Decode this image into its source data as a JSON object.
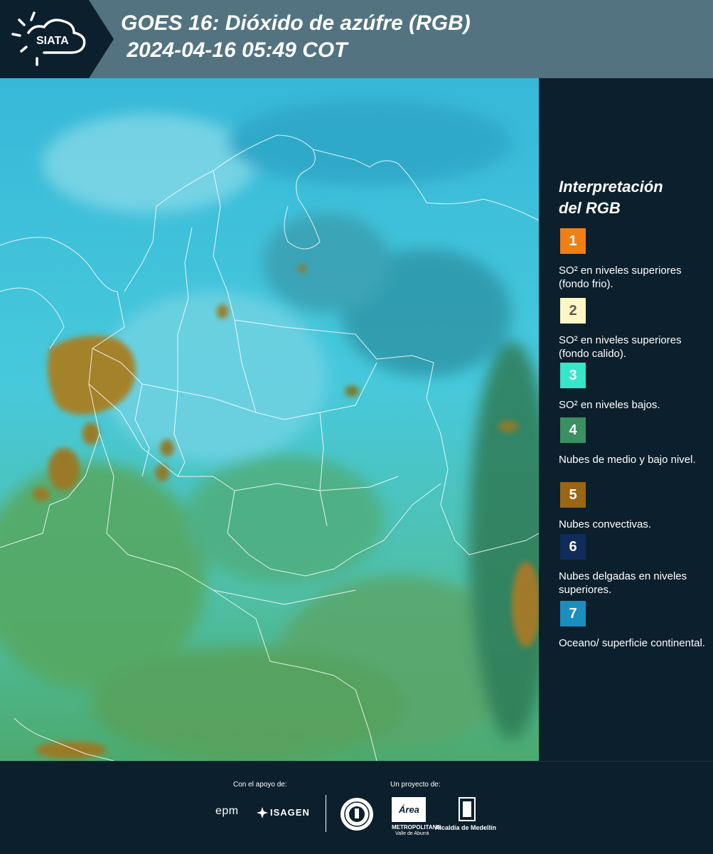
{
  "header": {
    "logo_text": "SIATA",
    "title_line1": "GOES 16: Dióxido de azúfre (RGB)",
    "title_line2": " 2024-04-16 05:49 COT"
  },
  "legend": {
    "title_line1": "Interpretación",
    "title_line2": "del RGB",
    "items": [
      {
        "number": "1",
        "color": "#f07f14",
        "text_color": "#ffffff",
        "description": "SO² en niveles superiores (fondo frio)."
      },
      {
        "number": "2",
        "color": "#fdf7c4",
        "text_color": "#5a5a5a",
        "description": "SO² en niveles superiores (fondo calido)."
      },
      {
        "number": "3",
        "color": "#35e6c8",
        "text_color": "#ffffff",
        "description": "SO² en niveles bajos."
      },
      {
        "number": "4",
        "color": "#3a8f63",
        "text_color": "#ffffff",
        "description": "Nubes de medio y bajo nivel."
      },
      {
        "number": "5",
        "color": "#9a6614",
        "text_color": "#ffffff",
        "description": "Nubes convectivas."
      },
      {
        "number": "6",
        "color": "#0f2c5b",
        "text_color": "#ffffff",
        "description": "Nubes delgadas en niveles superiores."
      },
      {
        "number": "7",
        "color": "#1b8ec0",
        "text_color": "#ffffff",
        "description": "Oceano/ superficie continental."
      }
    ]
  },
  "footer": {
    "support_caption": "Con el apoyo de:",
    "project_caption": "Un proyecto de:",
    "sponsor_epm": "epm",
    "sponsor_isagen": "ISAGEN",
    "sponsor_metro": "Área",
    "sponsor_metro_sub1": "METROPOLITANA",
    "sponsor_metro_sub2": "Valle de Aburrá",
    "sponsor_alcaldia": "Alcaldía de Medellín"
  }
}
